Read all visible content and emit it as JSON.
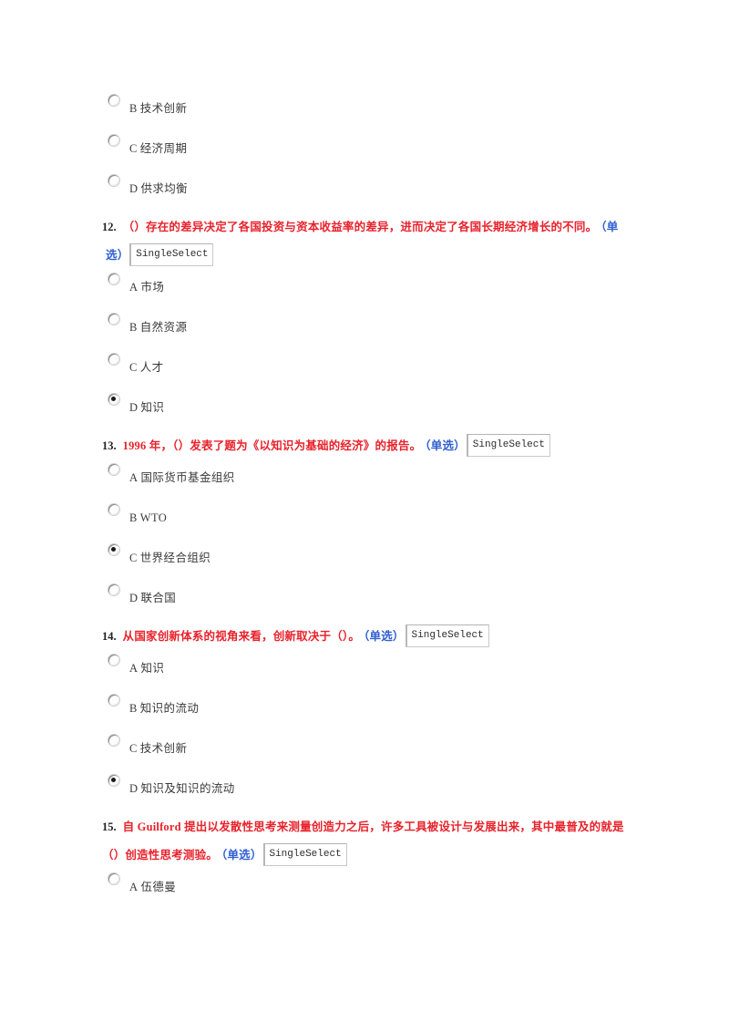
{
  "page": {
    "background_color": "#ffffff",
    "question_number_color": "#222222",
    "question_text_color": "#e8222b",
    "question_type_color": "#2f5fd0",
    "option_text_color": "#3a3a3a"
  },
  "trailing_options_q11": [
    {
      "tag": "B",
      "text": "技术创新",
      "checked": false
    },
    {
      "tag": "C",
      "text": "经济周期",
      "checked": false
    },
    {
      "tag": "D",
      "text": "供求均衡",
      "checked": false
    }
  ],
  "questions": [
    {
      "number": "12.",
      "text_line1": "（）存在的差异决定了各国投资与资本收益率的差异，进而决定了各国长期经济增长的不同。",
      "type_part1": "（单",
      "type_part2": "选）",
      "control_label": "SingleSelect",
      "two_line": true,
      "options": [
        {
          "tag": "A",
          "text": "市场",
          "checked": false
        },
        {
          "tag": "B",
          "text": "自然资源",
          "checked": false
        },
        {
          "tag": "C",
          "text": "人才",
          "checked": false
        },
        {
          "tag": "D",
          "text": "知识",
          "checked": true
        }
      ]
    },
    {
      "number": "13.",
      "text_line1": "1996 年，（）发表了题为《以知识为基础的经济》的报告。",
      "type_part1": "（单选）",
      "type_part2": "",
      "control_label": "SingleSelect",
      "two_line": false,
      "options": [
        {
          "tag": "A",
          "text": "国际货币基金组织",
          "checked": false
        },
        {
          "tag": "B",
          "text": "WTO",
          "checked": false
        },
        {
          "tag": "C",
          "text": "世界经合组织",
          "checked": true
        },
        {
          "tag": "D",
          "text": "联合国",
          "checked": false
        }
      ]
    },
    {
      "number": "14.",
      "text_line1": "从国家创新体系的视角来看，创新取决于（）。",
      "type_part1": "（单选）",
      "type_part2": "",
      "control_label": "SingleSelect",
      "two_line": false,
      "options": [
        {
          "tag": "A",
          "text": "知识",
          "checked": false
        },
        {
          "tag": "B",
          "text": "知识的流动",
          "checked": false
        },
        {
          "tag": "C",
          "text": "技术创新",
          "checked": false
        },
        {
          "tag": "D",
          "text": "知识及知识的流动",
          "checked": true
        }
      ]
    },
    {
      "number": "15.",
      "text_line1": "自 Guilford 提出以发散性思考来测量创造力之后，许多工具被设计与发展出来，其中最普及的就是",
      "text_line2": "（）创造性思考测验。",
      "type_part1": "（单选）",
      "type_part2": "",
      "control_label": "SingleSelect",
      "two_line": true,
      "options": [
        {
          "tag": "A",
          "text": "伍德曼",
          "checked": false
        }
      ]
    }
  ]
}
